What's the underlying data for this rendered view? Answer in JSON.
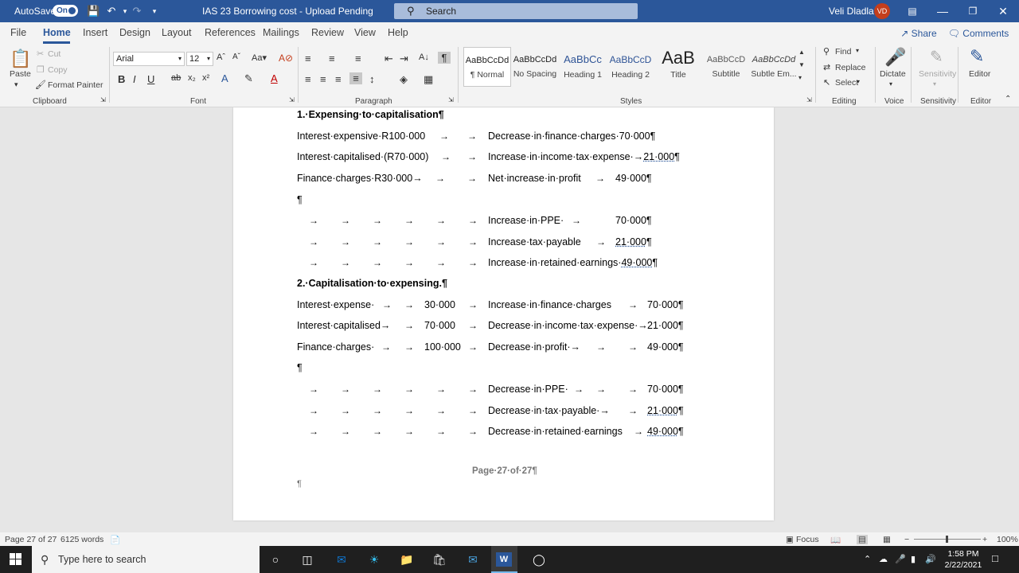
{
  "titlebar": {
    "autosave_label": "AutoSave",
    "autosave_state": "On",
    "doc_title": "IAS 23 Borrowing cost  -  Upload Pending",
    "search_placeholder": "Search",
    "user_name": "Veli Dladla",
    "user_initials": "VD"
  },
  "tabs": [
    "File",
    "Home",
    "Insert",
    "Design",
    "Layout",
    "References",
    "Mailings",
    "Review",
    "View",
    "Help"
  ],
  "share_label": "Share",
  "comments_label": "Comments",
  "ribbon": {
    "clipboard": {
      "paste": "Paste",
      "cut": "Cut",
      "copy": "Copy",
      "format_painter": "Format Painter",
      "group": "Clipboard"
    },
    "font": {
      "name": "Arial",
      "size": "12",
      "group": "Font"
    },
    "paragraph": {
      "group": "Paragraph"
    },
    "styles": {
      "group": "Styles",
      "items": [
        {
          "sample": "AaBbCcDd",
          "name": "¶ Normal"
        },
        {
          "sample": "AaBbCcDd",
          "name": "No Spacing"
        },
        {
          "sample": "AaBbCc",
          "name": "Heading 1"
        },
        {
          "sample": "AaBbCcD",
          "name": "Heading 2"
        },
        {
          "sample": "AaB",
          "name": "Title"
        },
        {
          "sample": "AaBbCcD",
          "name": "Subtitle"
        },
        {
          "sample": "AaBbCcDd",
          "name": "Subtle Em..."
        }
      ]
    },
    "editing": {
      "find": "Find",
      "replace": "Replace",
      "select": "Select",
      "group": "Editing"
    },
    "voice": {
      "dictate": "Dictate",
      "group": "Voice"
    },
    "sensitivity": {
      "label": "Sensitivity",
      "group": "Sensitivity"
    },
    "editor": {
      "label": "Editor",
      "group": "Editor"
    }
  },
  "document": {
    "heading1": "1.·Expensing·to·capitalisation¶",
    "heading2": "2.·Capitalisation·to·expensing.¶",
    "pilcrow": "¶",
    "arrow": "→",
    "s1": [
      {
        "left": "Interest·expensive·R100·000",
        "right": "Decrease·in·finance·charges·70·000¶"
      },
      {
        "left": "Interest·capitalised·(R70·000)",
        "right": "Increase·in·income·tax·expense·→",
        "right_amount": "21·000",
        "right_tail": "¶"
      },
      {
        "left": "Finance·charges·R30·000→",
        "right": "Net·increase·in·profit",
        "amount": "49·000¶"
      }
    ],
    "s1b": [
      {
        "label": "Increase·in·PPE·",
        "amount": "70·000¶"
      },
      {
        "label": "Increase·tax·payable",
        "amount": "21·000",
        "tail": "¶"
      },
      {
        "label": "Increase·in·retained·earnings·",
        "amount": "49·000",
        "tail": "¶"
      }
    ],
    "s2": [
      {
        "left": "Interest·expense·",
        "mid": "30·000",
        "right": "Increase·in·finance·charges",
        "amount": "70·000¶"
      },
      {
        "left": "Interest·capitalised→",
        "mid": "70·000",
        "right": "Decrease·in·income·tax·expense·→",
        "amount": "21·000¶"
      },
      {
        "left": "Finance·charges·",
        "mid": "100·000",
        "right": "Decrease·in·profit·→",
        "amount": "49·000¶"
      }
    ],
    "s2b": [
      {
        "label": "Decrease·in·PPE·",
        "amount": "70·000¶"
      },
      {
        "label": "Decrease·in·tax·payable·→",
        "amount": "21·000",
        "tail": "¶"
      },
      {
        "label": "Decrease·in·retained·earnings",
        "amount": "49·000",
        "tail": "¶"
      }
    ],
    "page_footer": "Page·27·of·27¶"
  },
  "statusbar": {
    "page": "Page 27 of 27",
    "words": "6125 words",
    "focus": "Focus",
    "zoom": "100%"
  },
  "taskbar": {
    "search_placeholder": "Type here to search",
    "time": "1:58 PM",
    "date": "2/22/2021"
  }
}
